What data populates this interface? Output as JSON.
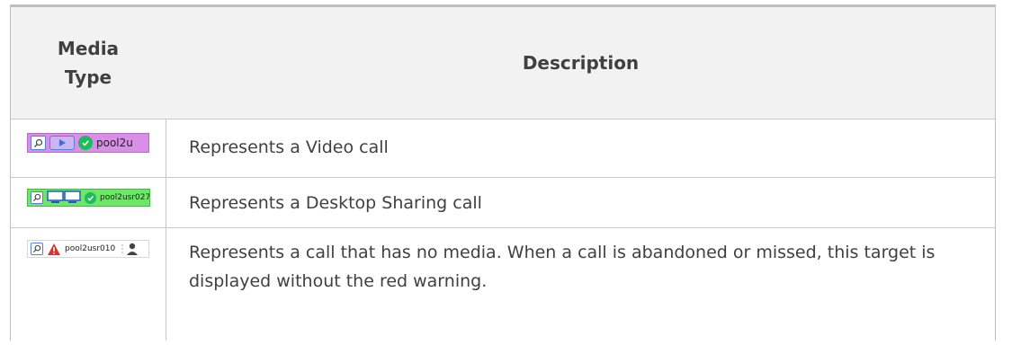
{
  "table": {
    "header": {
      "media_type": "Media Type",
      "description": "Description"
    },
    "rows": [
      {
        "media_icon": "video-call-target",
        "username": "pool2u",
        "bar_color": "#d98ee8",
        "description": "Represents a Video call"
      },
      {
        "media_icon": "desktop-sharing-target",
        "username": "pool2usr027",
        "bar_color": "#6ee66a",
        "description": "Represents a Desktop Sharing call"
      },
      {
        "media_icon": "no-media-target",
        "username": "pool2usr010",
        "bar_color": "#ffffff",
        "warning_color": "#d9342b",
        "description": "Represents a call that has no media. When a call is abandoned or missed, this target is displayed without the red warning."
      }
    ]
  }
}
